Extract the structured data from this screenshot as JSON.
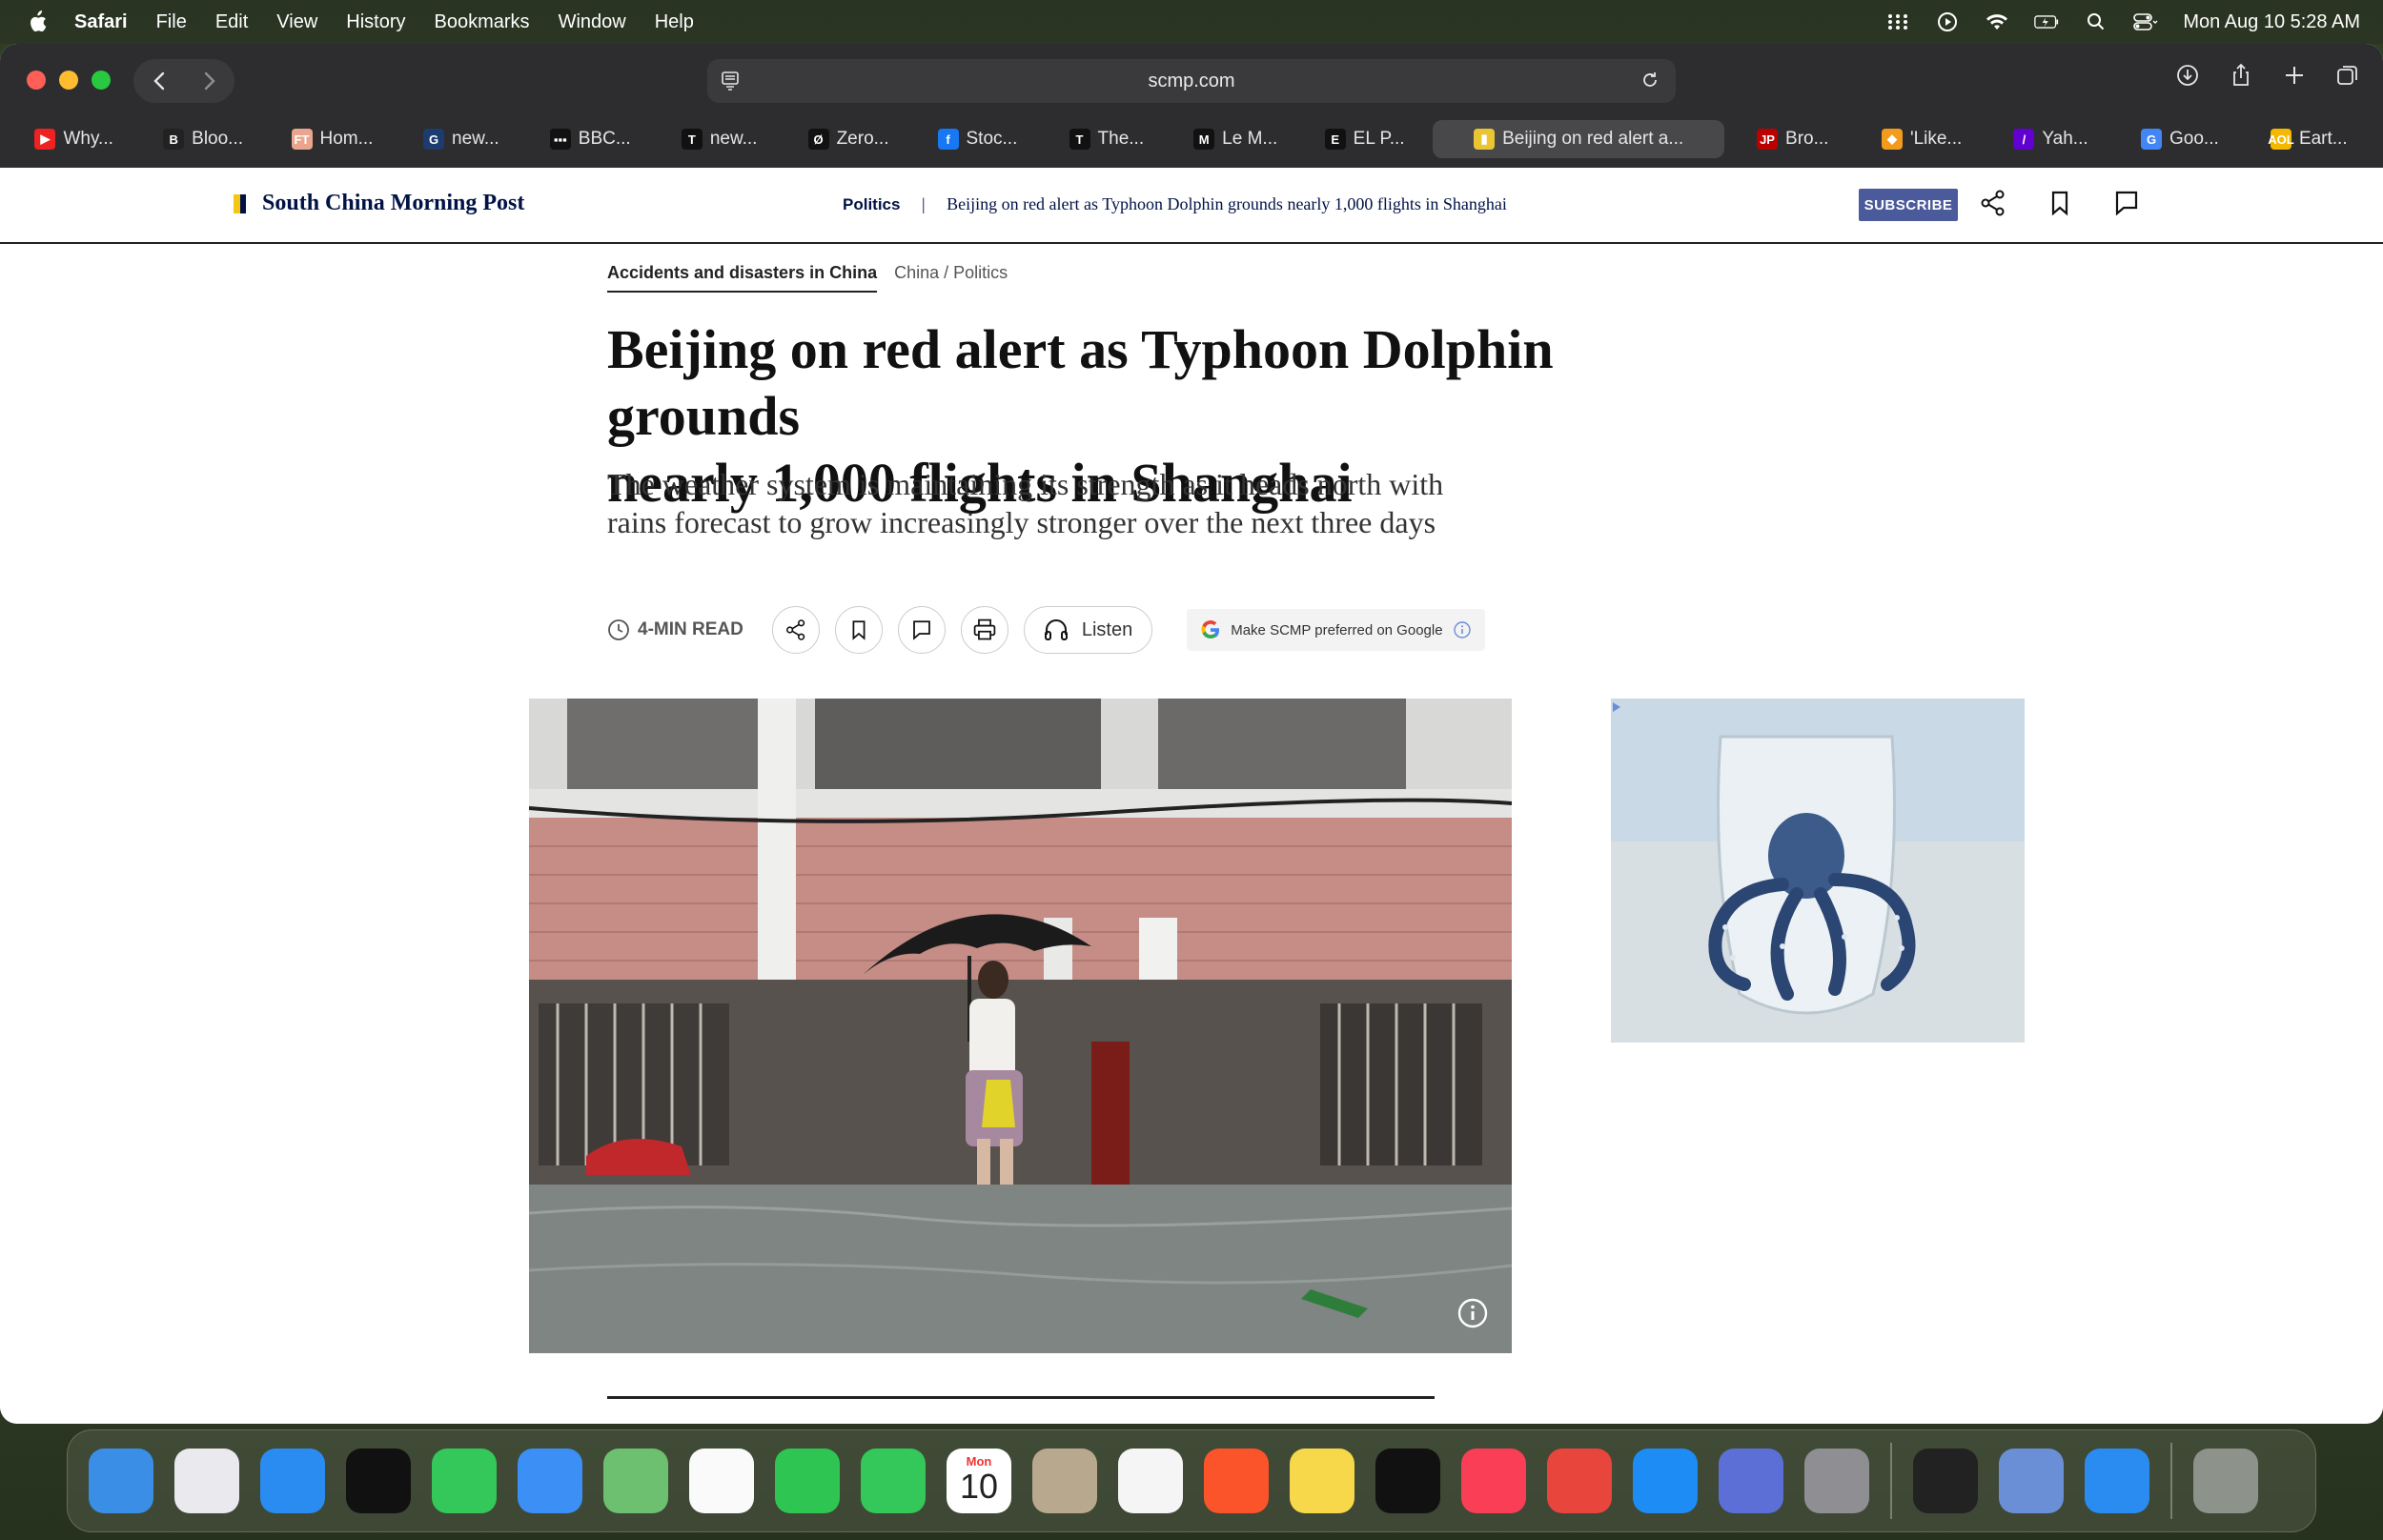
{
  "menubar": {
    "app_name": "Safari",
    "items": [
      "File",
      "Edit",
      "View",
      "History",
      "Bookmarks",
      "Window",
      "Help"
    ],
    "clock": "Mon Aug 10  5:28 AM"
  },
  "browser": {
    "address": "scmp.com",
    "tabs": [
      {
        "label": "Why...",
        "fav": "▶",
        "color": "#e22"
      },
      {
        "label": "Bloo...",
        "fav": "B",
        "color": "#222"
      },
      {
        "label": "Hom...",
        "fav": "FT",
        "color": "#e9a58d"
      },
      {
        "label": "new...",
        "fav": "G",
        "color": "#1c3b6e"
      },
      {
        "label": "BBC...",
        "fav": "▪▪▪",
        "color": "#111"
      },
      {
        "label": "new...",
        "fav": "T",
        "color": "#111"
      },
      {
        "label": "Zero...",
        "fav": "Ø",
        "color": "#111"
      },
      {
        "label": "Stoc...",
        "fav": "f",
        "color": "#1877f2"
      },
      {
        "label": "The...",
        "fav": "T",
        "color": "#111"
      },
      {
        "label": "Le M...",
        "fav": "M",
        "color": "#111"
      },
      {
        "label": "EL P...",
        "fav": "E",
        "color": "#111"
      },
      {
        "label": "Beijing on red alert a...",
        "fav": "▮",
        "color": "#e8c531",
        "active": true
      },
      {
        "label": "Bro...",
        "fav": "JP",
        "color": "#b00"
      },
      {
        "label": "'Like...",
        "fav": "◆",
        "color": "#f29b1d"
      },
      {
        "label": "Yah...",
        "fav": "/",
        "color": "#6001d2"
      },
      {
        "label": "Goo...",
        "fav": "G",
        "color": "#4285f4"
      },
      {
        "label": "Eart...",
        "fav": "AOL",
        "color": "#f5b800"
      }
    ]
  },
  "site": {
    "logo_text": "South China Morning Post",
    "brand_colors": {
      "navy": "#001246",
      "yellow": "#f5c518"
    },
    "sticky_section": "Politics",
    "sticky_sep": "|",
    "sticky_title": "Beijing on red alert as Typhoon Dolphin grounds nearly 1,000 flights in Shanghai",
    "subscribe_label": "SUBSCRIBE"
  },
  "article": {
    "primary_topic": "Accidents and disasters in China",
    "breadcrumb": "China / Politics",
    "headline_line1": "Beijing on red alert as Typhoon Dolphin grounds",
    "headline_line2": "nearly 1,000 flights in Shanghai",
    "subhead": "The weather system is maintaining its strength as it heads north with rains forecast to grow increasingly stronger over the next three days",
    "read_time": "4-MIN READ",
    "listen_label": "Listen",
    "google_pref": "Make SCMP preferred on Google"
  },
  "dock": {
    "calendar_month": "Mon",
    "calendar_day": "10",
    "apps": [
      {
        "name": "finder",
        "color": "#3a8ee6"
      },
      {
        "name": "launchpad",
        "color": "#e9e9ee"
      },
      {
        "name": "safari",
        "color": "#2a8cf0"
      },
      {
        "name": "podcast-wave",
        "color": "#111"
      },
      {
        "name": "messages",
        "color": "#34c759"
      },
      {
        "name": "mail",
        "color": "#3b8ff5"
      },
      {
        "name": "maps",
        "color": "#6cc070"
      },
      {
        "name": "photos",
        "color": "#fafafa"
      },
      {
        "name": "facetime",
        "color": "#2fc552"
      },
      {
        "name": "phone",
        "color": "#34c759"
      },
      {
        "name": "calendar",
        "color": "#ffffff"
      },
      {
        "name": "contacts",
        "color": "#b8a98e"
      },
      {
        "name": "reminders",
        "color": "#f5f5f5"
      },
      {
        "name": "brave",
        "color": "#fb542b"
      },
      {
        "name": "notes",
        "color": "#f7d84a"
      },
      {
        "name": "tv",
        "color": "#111"
      },
      {
        "name": "music",
        "color": "#fa3e56"
      },
      {
        "name": "rocket",
        "color": "#e8453c"
      },
      {
        "name": "app-store",
        "color": "#1e8cf5"
      },
      {
        "name": "simulator",
        "color": "#5b6fd6"
      },
      {
        "name": "system-settings",
        "color": "#8e8e93"
      }
    ]
  }
}
